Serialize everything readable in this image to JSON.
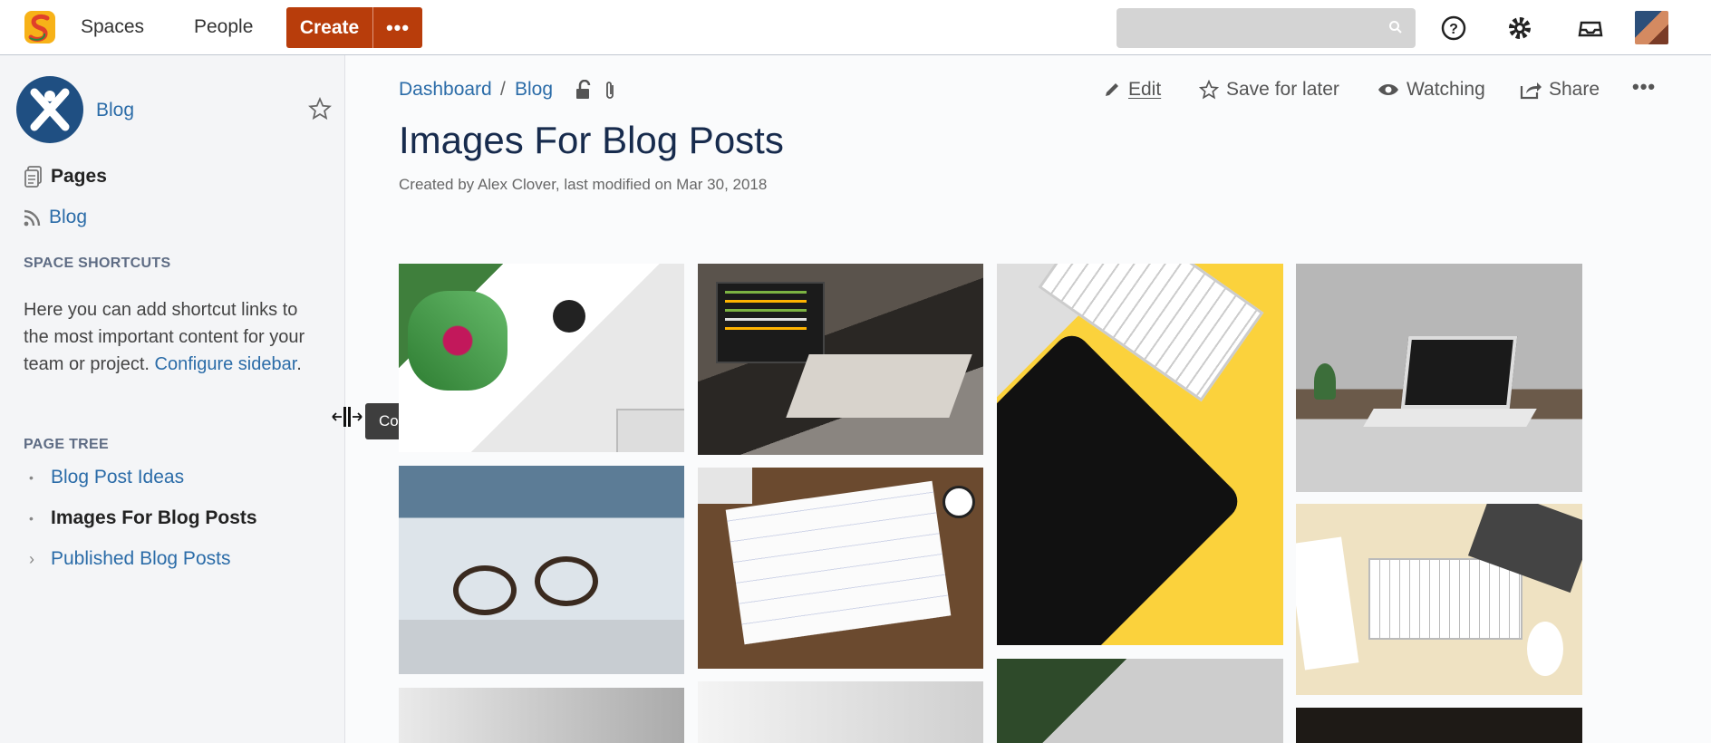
{
  "topbar": {
    "spaces": "Spaces",
    "people": "People",
    "create": "Create",
    "create_more": "•••",
    "search_placeholder": ""
  },
  "sidebar": {
    "space_name": "Blog",
    "pages": "Pages",
    "blog": "Blog",
    "shortcuts_heading": "SPACE SHORTCUTS",
    "shortcuts_text": "Here you can add shortcut links to the most important content for your team or project.",
    "configure_link": "Configure sidebar",
    "page_tree_heading": "PAGE TREE",
    "tree": [
      {
        "label": "Blog Post Ideas",
        "bullet": "•"
      },
      {
        "label": "Images For Blog Posts",
        "bullet": "•"
      },
      {
        "label": "Published Blog Posts",
        "bullet": "›"
      }
    ],
    "tooltip": "Collapse sidebar ( [ )"
  },
  "page": {
    "breadcrumbs": [
      "Dashboard",
      "Blog"
    ],
    "crumb_sep": "/",
    "actions": {
      "edit": "Edit",
      "save": "Save for later",
      "watching": "Watching",
      "share": "Share",
      "more": "•••"
    },
    "title": "Images For Blog Posts",
    "meta": "Created by Alex Clover, last modified on Mar 30, 2018"
  },
  "icons": [
    "app-logo-icon",
    "search-icon",
    "help-icon",
    "gear-icon",
    "inbox-icon",
    "star-icon",
    "pages-icon",
    "rss-icon",
    "lock-icon",
    "attachment-icon",
    "pencil-icon",
    "eye-icon",
    "share-icon"
  ],
  "colors": {
    "brand": "#b83d0b",
    "link": "#2b6ca8",
    "space_logo": "#1f4f82"
  }
}
